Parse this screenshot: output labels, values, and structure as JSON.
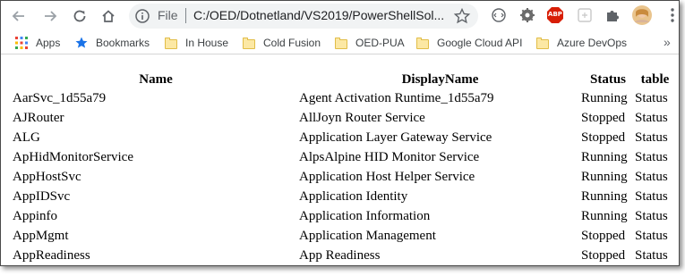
{
  "toolbar": {
    "scheme_label": "File",
    "url": "C:/OED/Dotnetland/VS2019/PowerShellSol...",
    "buttons": [
      "back-icon",
      "forward-icon",
      "reload-icon",
      "home-icon"
    ],
    "extensions": [
      "extension-circle-icon",
      "gear-extension-icon",
      "adblock-icon",
      "extension-square-icon",
      "puzzle-icon",
      "profile-avatar",
      "more-vert-icon"
    ],
    "adblock_label": "ABP"
  },
  "bookmarks": {
    "items": [
      {
        "label": "Apps",
        "icon": "apps-grid-icon"
      },
      {
        "label": "Bookmarks",
        "icon": "star-icon"
      },
      {
        "label": "In House",
        "icon": "folder-icon"
      },
      {
        "label": "Cold Fusion",
        "icon": "folder-icon"
      },
      {
        "label": "OED-PUA",
        "icon": "folder-icon"
      },
      {
        "label": "Google Cloud API",
        "icon": "folder-icon"
      },
      {
        "label": "Azure DevOps",
        "icon": "folder-icon"
      }
    ],
    "overflow": "»"
  },
  "table": {
    "headers": [
      "Name",
      "DisplayName",
      "Status",
      "table"
    ],
    "rows": [
      {
        "name": "AarSvc_1d55a79",
        "display": "Agent Activation Runtime_1d55a79",
        "status": "Running",
        "table": "Status"
      },
      {
        "name": "AJRouter",
        "display": "AllJoyn Router Service",
        "status": "Stopped",
        "table": "Status"
      },
      {
        "name": "ALG",
        "display": "Application Layer Gateway Service",
        "status": "Stopped",
        "table": "Status"
      },
      {
        "name": "ApHidMonitorService",
        "display": "AlpsAlpine HID Monitor Service",
        "status": "Running",
        "table": "Status"
      },
      {
        "name": "AppHostSvc",
        "display": "Application Host Helper Service",
        "status": "Running",
        "table": "Status"
      },
      {
        "name": "AppIDSvc",
        "display": "Application Identity",
        "status": "Running",
        "table": "Status"
      },
      {
        "name": "Appinfo",
        "display": "Application Information",
        "status": "Running",
        "table": "Status"
      },
      {
        "name": "AppMgmt",
        "display": "Application Management",
        "status": "Stopped",
        "table": "Status"
      },
      {
        "name": "AppReadiness",
        "display": "App Readiness",
        "status": "Stopped",
        "table": "Status"
      }
    ]
  },
  "colors": {
    "adblock_red": "#d81e06",
    "bookmark_star": "#1a73e8",
    "folder": "#fce8a4",
    "text": "#000000"
  }
}
